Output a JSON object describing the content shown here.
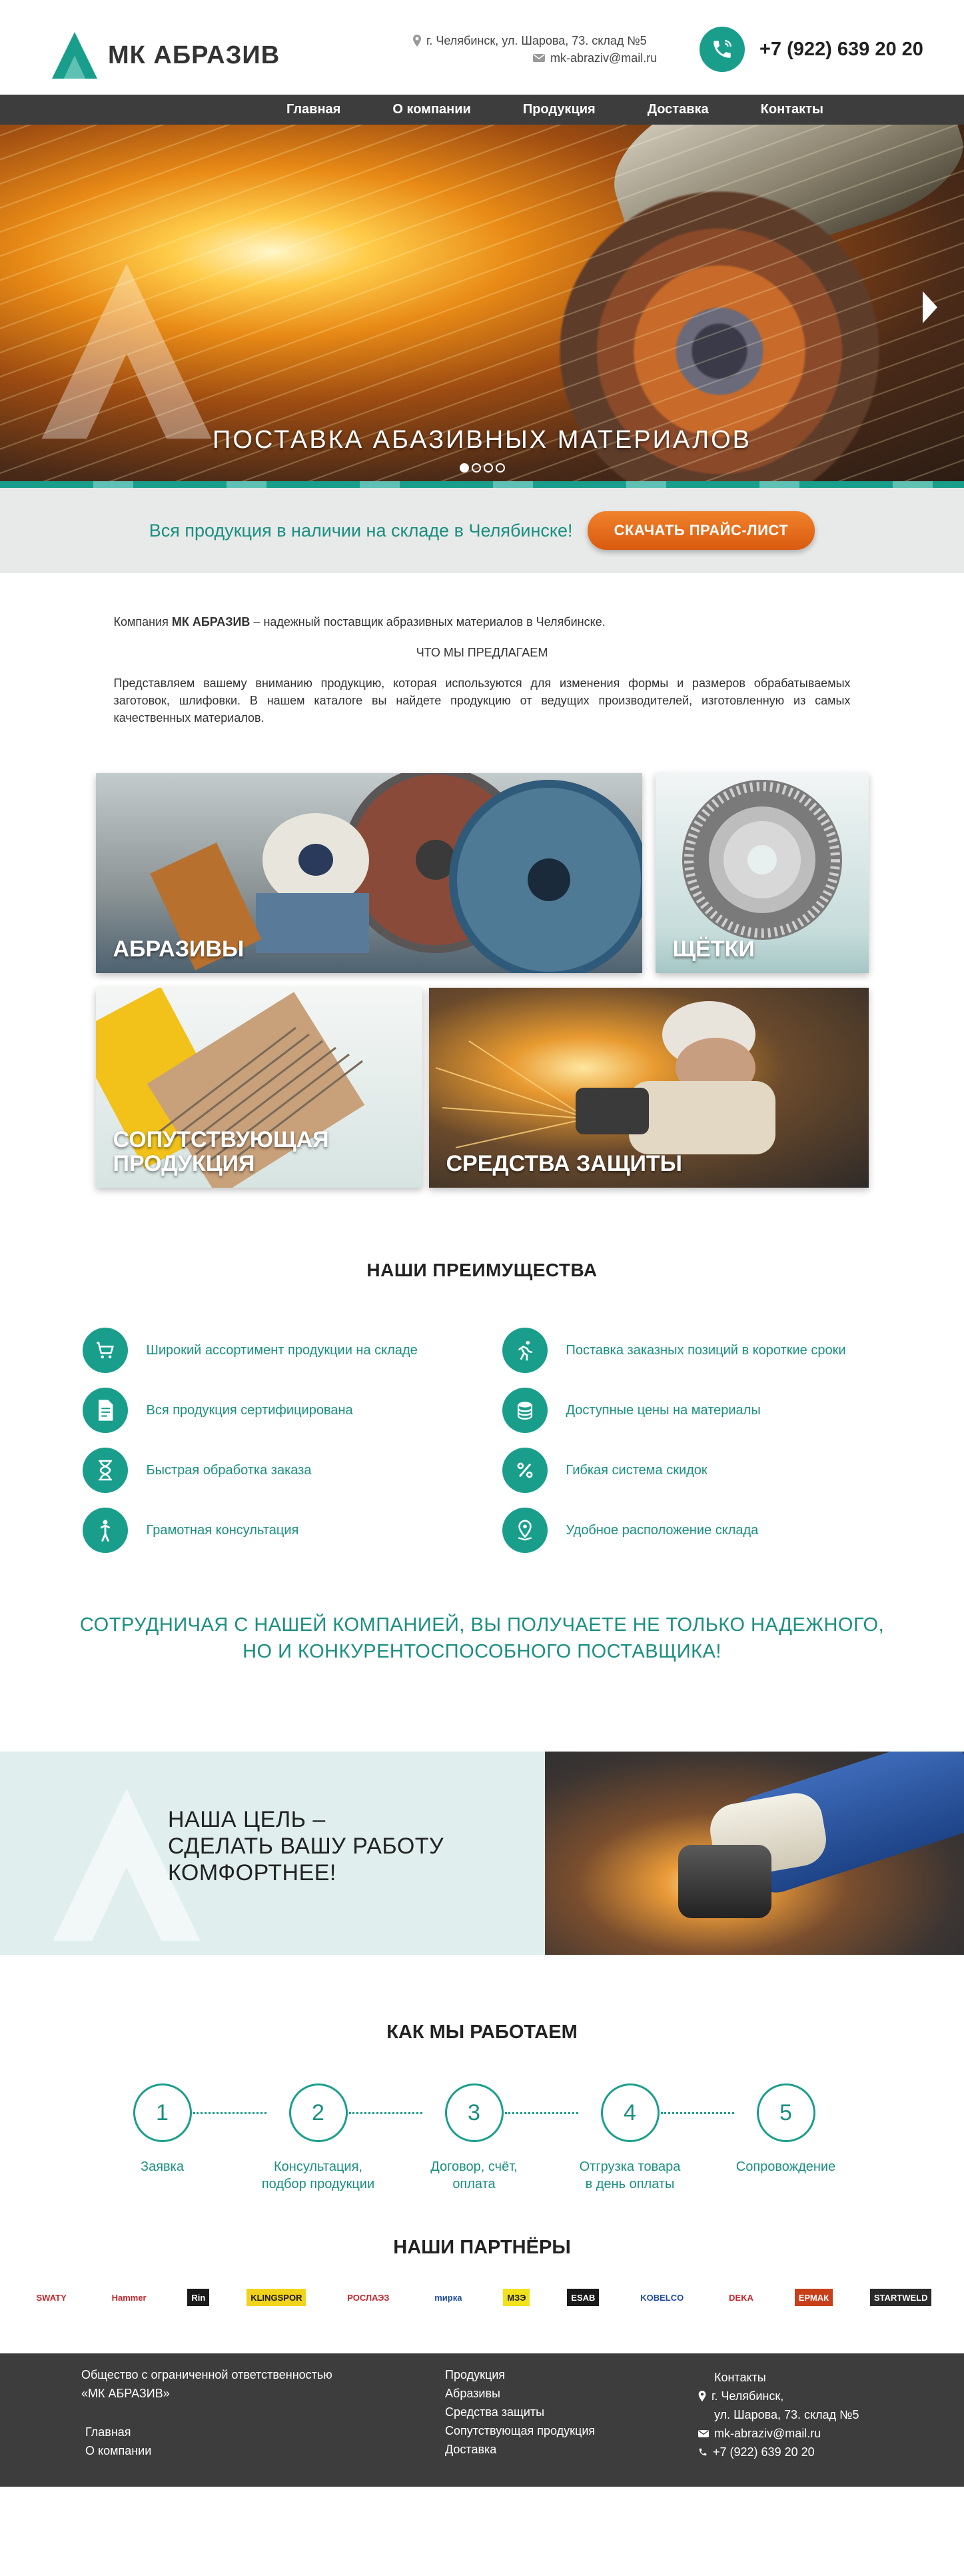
{
  "header": {
    "logo_text": "МК АБРАЗИВ",
    "address": "г. Челябинск, ул. Шарова, 73. склад №5",
    "email": "mk-abraziv@mail.ru",
    "phone": "+7 (922) 639 20 20"
  },
  "nav": {
    "items": [
      {
        "label": "Главная"
      },
      {
        "label": "О компании"
      },
      {
        "label": "Продукция"
      },
      {
        "label": "Доставка"
      },
      {
        "label": "Контакты"
      }
    ]
  },
  "hero": {
    "title": "ПОСТАВКА АБАЗИВНЫХ МАТЕРИАЛОВ",
    "slide_count": 4,
    "active_slide": 1
  },
  "price_strip": {
    "text": "Вся продукция в наличии на складе в Челябинске!",
    "button": "СКАЧАТЬ ПРАЙС-ЛИСТ"
  },
  "intro": {
    "p1_prefix": "Компания ",
    "p1_brand": "МК АБРАЗИВ",
    "p1_suffix": " – надежный поставщик абразивных материалов в Челябинске.",
    "heading": "ЧТО МЫ ПРЕДЛАГАЕМ",
    "p2": "Представляем вашему вниманию продукцию, которая используются для изменения формы и размеров обрабатываемых заготовок, шлифовки. В нашем каталоге вы найдете продукцию от ведущих производителей, изготовленную из самых качественных материалов."
  },
  "categories": {
    "abrasives": "АБРАЗИВЫ",
    "brushes": "ЩЁТКИ",
    "related_line1": "СОПУТСТВУЮЩАЯ",
    "related_line2": "ПРОДУКЦИЯ",
    "protection": "СРЕДСТВА ЗАЩИТЫ"
  },
  "advantages": {
    "title": "НАШИ ПРЕИМУЩЕСТВА",
    "items": [
      {
        "text": "Широкий ассортимент продукции на складе",
        "icon": "cart-icon"
      },
      {
        "text": "Поставка заказных позиций в короткие сроки",
        "icon": "runner-icon"
      },
      {
        "text": "Вся продукция сертифицирована",
        "icon": "document-icon"
      },
      {
        "text": "Доступные цены на материалы",
        "icon": "coins-icon"
      },
      {
        "text": "Быстрая обработка заказа",
        "icon": "hourglass-icon"
      },
      {
        "text": "Гибкая система скидок",
        "icon": "percent-icon"
      },
      {
        "text": "Грамотная консультация",
        "icon": "person-icon"
      },
      {
        "text": "Удобное расположение склада",
        "icon": "map-pin-icon"
      }
    ],
    "slogan_line1": "СОТРУДНИЧАЯ С НАШЕЙ КОМПАНИЕЙ, ВЫ ПОЛУЧАЕТЕ НЕ ТОЛЬКО НАДЕЖНОГО,",
    "slogan_line2": "НО И КОНКУРЕНТОСПОСОБНОГО ПОСТАВЩИКА!"
  },
  "goal": {
    "line1": "НАША ЦЕЛЬ –",
    "line2": "СДЕЛАТЬ ВАШУ РАБОТУ",
    "line3": "КОМФОРТНЕЕ!"
  },
  "how": {
    "title": "КАК МЫ РАБОТАЕМ",
    "steps": [
      {
        "num": "1",
        "line1": "Заявка",
        "line2": ""
      },
      {
        "num": "2",
        "line1": "Консультация,",
        "line2": "подбор продукции"
      },
      {
        "num": "3",
        "line1": "Договор, счёт,",
        "line2": "оплата"
      },
      {
        "num": "4",
        "line1": "Отгрузка товара",
        "line2": "в день оплаты"
      },
      {
        "num": "5",
        "line1": "Сопровождение",
        "line2": ""
      }
    ]
  },
  "partners": {
    "title": "НАШИ ПАРТНЁРЫ",
    "logos": [
      {
        "name": "SWATY",
        "color": "#c0262d",
        "bg": "#ffffff"
      },
      {
        "name": "Hammer",
        "color": "#c0262d",
        "bg": "#ffffff"
      },
      {
        "name": "Rin",
        "color": "#ffffff",
        "bg": "#1a1a1a"
      },
      {
        "name": "KLINGSPOR",
        "color": "#1a1a1a",
        "bg": "#f2d31b"
      },
      {
        "name": "РОСЛАЭЗ",
        "color": "#c0262d",
        "bg": "#ffffff"
      },
      {
        "name": "mирка",
        "color": "#1e4a9a",
        "bg": "#ffffff"
      },
      {
        "name": "МЗЭ",
        "color": "#1a1a1a",
        "bg": "#f2e21b"
      },
      {
        "name": "ESAB",
        "color": "#ffffff",
        "bg": "#1a1a1a"
      },
      {
        "name": "KOBELCO",
        "color": "#1e4a9a",
        "bg": "#ffffff"
      },
      {
        "name": "DEKA",
        "color": "#c0262d",
        "bg": "#ffffff"
      },
      {
        "name": "ЕРМАК",
        "color": "#ffffff",
        "bg": "#c8401a"
      },
      {
        "name": "STARTWELD",
        "color": "#ffffff",
        "bg": "#2a2a2a"
      }
    ]
  },
  "footer": {
    "company_line1": "Общество с ограниченной ответственностью",
    "company_line2": "«МК АБРАЗИВ»",
    "links_left": [
      "Главная",
      "О компании"
    ],
    "links_mid": [
      "Продукция",
      "Абразивы",
      "Средства защиты",
      "Сопутствующая продукция",
      "Доставка"
    ],
    "contacts_title": "Контакты",
    "city": "г. Челябинск,",
    "street": "ул. Шарова, 73. склад №5",
    "email": "mk-abraziv@mail.ru",
    "phone": "+7 (922) 639 20 20"
  },
  "colors": {
    "accent": "#1a9e8c",
    "accent_text": "#1a8f80",
    "nav_bg": "#3d3d3d",
    "button_orange": "#e8691c"
  }
}
